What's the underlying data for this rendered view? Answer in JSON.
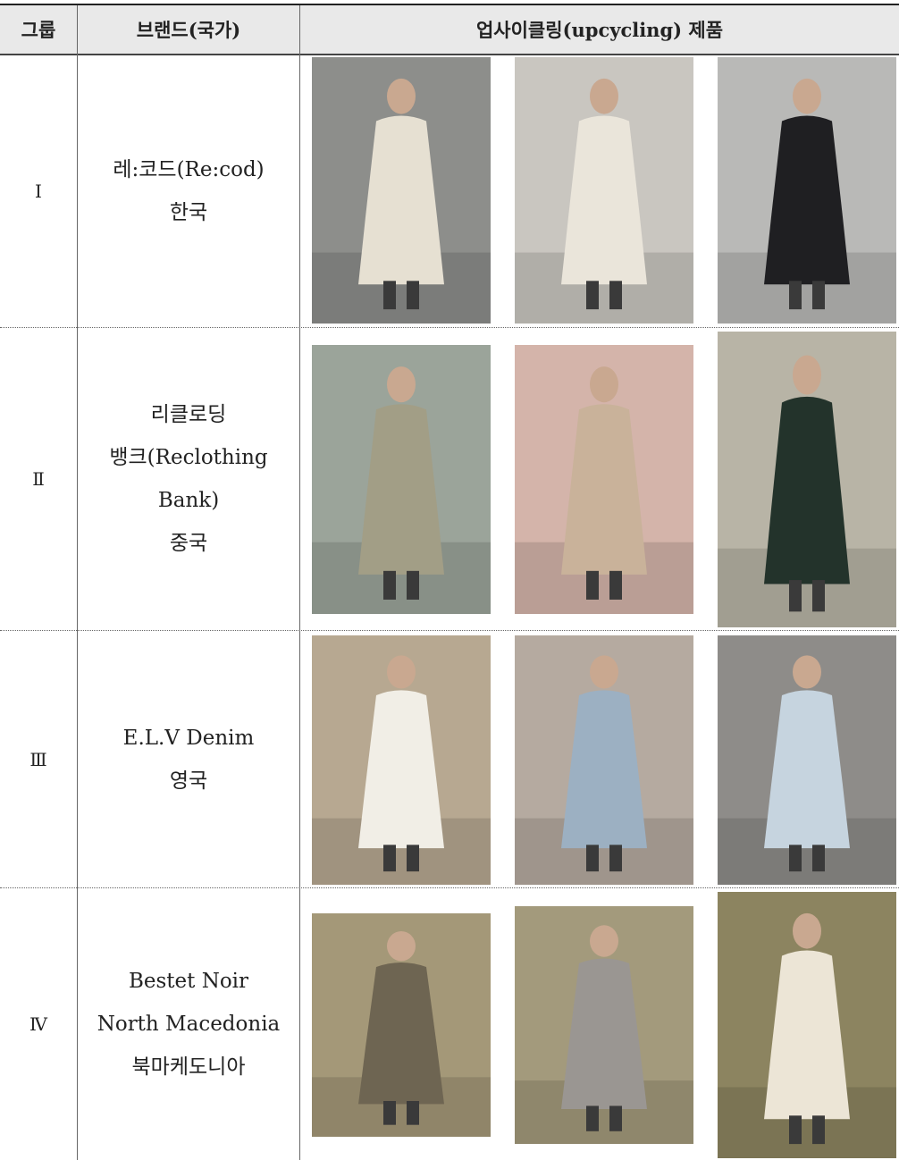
{
  "header": {
    "group": "그룹",
    "brand": "브랜드(국가)",
    "products": "업사이클링(upcycling) 제품"
  },
  "rows": [
    {
      "group": "Ⅰ",
      "brand_lines": [
        "레:코드(Re:cod)",
        "한국"
      ],
      "photos": [
        {
          "icon": "woman-in-white-suit-photo",
          "bg": "#8d8e8b",
          "fg": "#e6e0d2"
        },
        {
          "icon": "cream-sweatshirt-photo",
          "bg": "#c9c6c0",
          "fg": "#eae5da"
        },
        {
          "icon": "black-quilted-dress-photo",
          "bg": "#b9b9b7",
          "fg": "#1f1f22"
        }
      ]
    },
    {
      "group": "Ⅱ",
      "brand_lines": [
        "리클로딩",
        "뱅크(Reclothing",
        "Bank)",
        "중국"
      ],
      "photos": [
        {
          "icon": "patchwork-trench-coat-photo",
          "bg": "#9ba49a",
          "fg": "#a29e86"
        },
        {
          "icon": "printed-jacket-shirt-dress-photo",
          "bg": "#d4b4aa",
          "fg": "#c9b29a"
        },
        {
          "icon": "graphic-knit-coat-photo",
          "bg": "#b8b4a6",
          "fg": "#23332b"
        }
      ]
    },
    {
      "group": "Ⅲ",
      "brand_lines": [
        "E.L.V Denim",
        "영국"
      ],
      "photos": [
        {
          "icon": "white-shirt-dress-photo",
          "bg": "#b7a891",
          "fg": "#f1eee6"
        },
        {
          "icon": "denim-skirt-photo",
          "bg": "#b5aaa0",
          "fg": "#9cb0c2"
        },
        {
          "icon": "striped-shirt-shorts-photo",
          "bg": "#8e8c89",
          "fg": "#c6d4df"
        }
      ]
    },
    {
      "group": "Ⅳ",
      "brand_lines": [
        "Bestet Noir",
        "North Macedonia",
        "북마케도니아"
      ],
      "photos": [
        {
          "icon": "checked-jacket-field-photo",
          "bg": "#a49878",
          "fg": "#6e6552"
        },
        {
          "icon": "grey-coat-meadow-photo",
          "bg": "#a39a7c",
          "fg": "#9a9692"
        },
        {
          "icon": "cream-coat-grass-photo",
          "bg": "#8c8460",
          "fg": "#ece5d6"
        }
      ]
    }
  ]
}
